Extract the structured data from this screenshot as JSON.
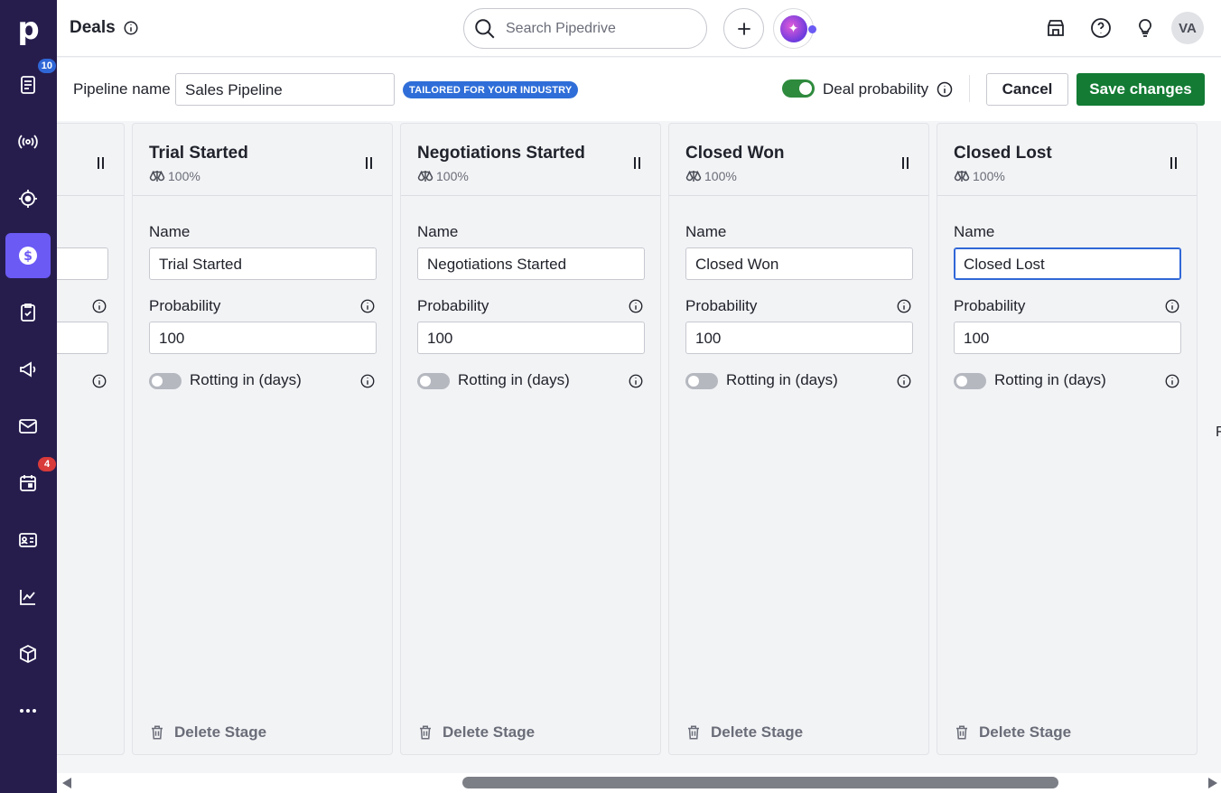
{
  "sidebar": {
    "logo": "p",
    "items": [
      {
        "icon": "leads-icon",
        "badge": "10"
      },
      {
        "icon": "broadcast-icon"
      },
      {
        "icon": "target-icon"
      },
      {
        "icon": "deals-dollar-icon",
        "active": true
      },
      {
        "icon": "clipboard-check-icon"
      },
      {
        "icon": "megaphone-icon"
      },
      {
        "icon": "mail-icon"
      },
      {
        "icon": "calendar-icon",
        "badge": "4"
      },
      {
        "icon": "contact-card-icon"
      },
      {
        "icon": "insights-chart-icon"
      },
      {
        "icon": "products-box-icon"
      },
      {
        "icon": "more-dots-icon"
      }
    ]
  },
  "header": {
    "title": "Deals",
    "search_placeholder": "Search Pipedrive",
    "avatar_initials": "VA"
  },
  "toolbar": {
    "pipeline_label": "Pipeline name",
    "pipeline_value": "Sales Pipeline",
    "tailored_badge": "TAILORED FOR YOUR INDUSTRY",
    "deal_probability_label": "Deal probability",
    "deal_probability_enabled": true,
    "cancel_label": "Cancel",
    "save_label": "Save changes"
  },
  "stages": [
    {
      "title": "Trial Started",
      "probability_display": "100%",
      "name_label": "Name",
      "name_value": "Trial Started",
      "probability_label": "Probability",
      "probability_value": "100",
      "rotting_label": "Rotting in (days)",
      "rotting_enabled": false,
      "delete_label": "Delete Stage"
    },
    {
      "title": "Negotiations Started",
      "probability_display": "100%",
      "name_label": "Name",
      "name_value": "Negotiations Started",
      "probability_label": "Probability",
      "probability_value": "100",
      "rotting_label": "Rotting in (days)",
      "rotting_enabled": false,
      "delete_label": "Delete Stage"
    },
    {
      "title": "Closed Won",
      "probability_display": "100%",
      "name_label": "Name",
      "name_value": "Closed Won",
      "probability_label": "Probability",
      "probability_value": "100",
      "rotting_label": "Rotting in (days)",
      "rotting_enabled": false,
      "delete_label": "Delete Stage"
    },
    {
      "title": "Closed Lost",
      "probability_display": "100%",
      "name_label": "Name",
      "name_value": "Closed Lost",
      "probability_label": "Probability",
      "probability_value": "100",
      "rotting_label": "Rotting in (days)",
      "rotting_enabled": false,
      "delete_label": "Delete Stage"
    }
  ],
  "edge_text": "F"
}
